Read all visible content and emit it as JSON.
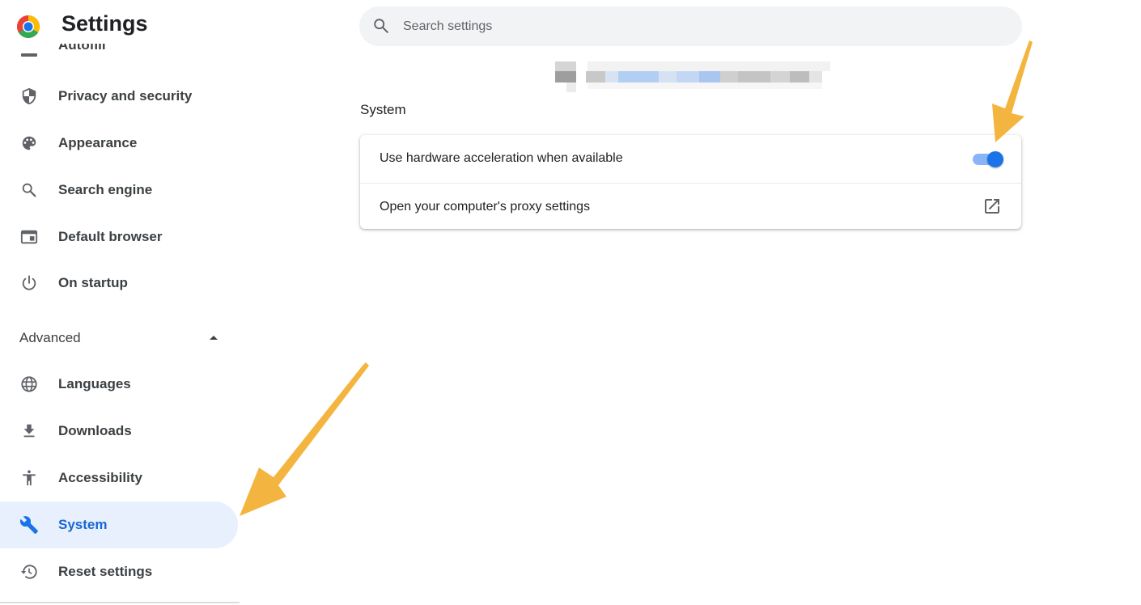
{
  "header": {
    "title": "Settings",
    "logo_icon": "chrome-logo-icon"
  },
  "search": {
    "placeholder": "Search settings",
    "value": "",
    "icon": "search-icon"
  },
  "sidebar": {
    "partial_item_label": "Autofill",
    "items": [
      {
        "label": "Privacy and security",
        "icon": "shield-icon"
      },
      {
        "label": "Appearance",
        "icon": "palette-icon"
      },
      {
        "label": "Search engine",
        "icon": "search-icon"
      },
      {
        "label": "Default browser",
        "icon": "browser-window-icon"
      },
      {
        "label": "On startup",
        "icon": "power-icon"
      }
    ],
    "advanced": {
      "label": "Advanced",
      "expanded": true,
      "icon": "caret-up-icon"
    },
    "advanced_items": [
      {
        "label": "Languages",
        "icon": "globe-icon"
      },
      {
        "label": "Downloads",
        "icon": "download-icon"
      },
      {
        "label": "Accessibility",
        "icon": "accessibility-icon"
      },
      {
        "label": "System",
        "icon": "wrench-icon",
        "selected": true
      },
      {
        "label": "Reset settings",
        "icon": "restore-icon"
      }
    ]
  },
  "main": {
    "section_title": "System",
    "rows": [
      {
        "label": "Use hardware acceleration when available",
        "control": "toggle",
        "checked": true
      },
      {
        "label": "Open your computer's proxy settings",
        "control": "external-link",
        "icon": "open-in-new-icon"
      }
    ]
  },
  "colors": {
    "accent": "#1a73e8",
    "selected_bg": "#e8f0fe",
    "selected_text": "#1967d2",
    "annotation_arrow": "#f4b540"
  }
}
